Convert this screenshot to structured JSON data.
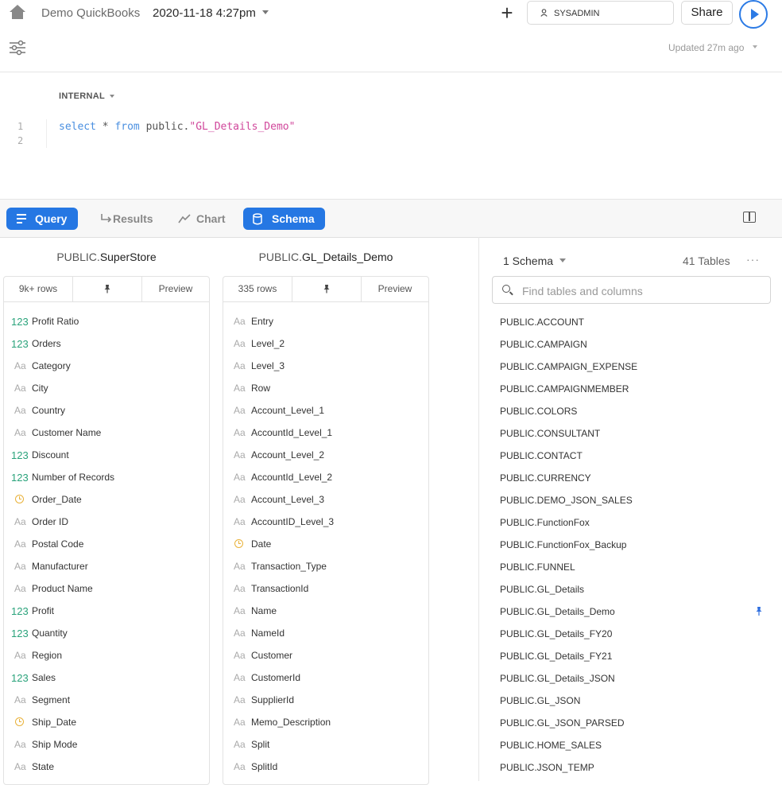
{
  "header": {
    "app_name": "Demo QuickBooks",
    "worksheet_title": "2020-11-18 4:27pm",
    "role": "SYSADMIN",
    "share_label": "Share",
    "updated": "Updated 27m ago"
  },
  "editor": {
    "database": "INTERNAL",
    "line_numbers": [
      "1",
      "2"
    ],
    "sql": {
      "kw_select": "select",
      "star": " * ",
      "kw_from": "from",
      "schema": " public.",
      "table_str": "\"GL_Details_Demo\""
    }
  },
  "toolbar": {
    "tabs": [
      {
        "label": "Query"
      },
      {
        "label": "Results"
      },
      {
        "label": "Chart"
      },
      {
        "label": "Schema"
      }
    ]
  },
  "cards": [
    {
      "schema_prefix": "PUBLIC.",
      "table_name": "SuperStore",
      "rows": "9k+ rows",
      "preview": "Preview",
      "columns": [
        {
          "type": "num",
          "type_label": "123",
          "name": "Profit Ratio"
        },
        {
          "type": "num",
          "type_label": "123",
          "name": "Orders"
        },
        {
          "type": "txt",
          "type_label": "Aa",
          "name": "Category"
        },
        {
          "type": "txt",
          "type_label": "Aa",
          "name": "City"
        },
        {
          "type": "txt",
          "type_label": "Aa",
          "name": "Country"
        },
        {
          "type": "txt",
          "type_label": "Aa",
          "name": "Customer Name"
        },
        {
          "type": "num",
          "type_label": "123",
          "name": "Discount"
        },
        {
          "type": "num",
          "type_label": "123",
          "name": "Number of Records"
        },
        {
          "type": "date",
          "type_label": "",
          "name": "Order_Date"
        },
        {
          "type": "txt",
          "type_label": "Aa",
          "name": "Order ID"
        },
        {
          "type": "txt",
          "type_label": "Aa",
          "name": "Postal Code"
        },
        {
          "type": "txt",
          "type_label": "Aa",
          "name": "Manufacturer"
        },
        {
          "type": "txt",
          "type_label": "Aa",
          "name": "Product Name"
        },
        {
          "type": "num",
          "type_label": "123",
          "name": "Profit"
        },
        {
          "type": "num",
          "type_label": "123",
          "name": "Quantity"
        },
        {
          "type": "txt",
          "type_label": "Aa",
          "name": "Region"
        },
        {
          "type": "num",
          "type_label": "123",
          "name": "Sales"
        },
        {
          "type": "txt",
          "type_label": "Aa",
          "name": "Segment"
        },
        {
          "type": "date",
          "type_label": "",
          "name": "Ship_Date"
        },
        {
          "type": "txt",
          "type_label": "Aa",
          "name": "Ship Mode"
        },
        {
          "type": "txt",
          "type_label": "Aa",
          "name": "State"
        }
      ]
    },
    {
      "schema_prefix": "PUBLIC.",
      "table_name": "GL_Details_Demo",
      "rows": "335 rows",
      "preview": "Preview",
      "columns": [
        {
          "type": "txt",
          "type_label": "Aa",
          "name": "Entry"
        },
        {
          "type": "txt",
          "type_label": "Aa",
          "name": "Level_2"
        },
        {
          "type": "txt",
          "type_label": "Aa",
          "name": "Level_3"
        },
        {
          "type": "txt",
          "type_label": "Aa",
          "name": "Row"
        },
        {
          "type": "txt",
          "type_label": "Aa",
          "name": "Account_Level_1"
        },
        {
          "type": "txt",
          "type_label": "Aa",
          "name": "AccountId_Level_1"
        },
        {
          "type": "txt",
          "type_label": "Aa",
          "name": "Account_Level_2"
        },
        {
          "type": "txt",
          "type_label": "Aa",
          "name": "AccountId_Level_2"
        },
        {
          "type": "txt",
          "type_label": "Aa",
          "name": "Account_Level_3"
        },
        {
          "type": "txt",
          "type_label": "Aa",
          "name": "AccountID_Level_3"
        },
        {
          "type": "date",
          "type_label": "",
          "name": "Date"
        },
        {
          "type": "txt",
          "type_label": "Aa",
          "name": "Transaction_Type"
        },
        {
          "type": "txt",
          "type_label": "Aa",
          "name": "TransactionId"
        },
        {
          "type": "txt",
          "type_label": "Aa",
          "name": "Name"
        },
        {
          "type": "txt",
          "type_label": "Aa",
          "name": "NameId"
        },
        {
          "type": "txt",
          "type_label": "Aa",
          "name": "Customer"
        },
        {
          "type": "txt",
          "type_label": "Aa",
          "name": "CustomerId"
        },
        {
          "type": "txt",
          "type_label": "Aa",
          "name": "SupplierId"
        },
        {
          "type": "txt",
          "type_label": "Aa",
          "name": "Memo_Description"
        },
        {
          "type": "txt",
          "type_label": "Aa",
          "name": "Split"
        },
        {
          "type": "txt",
          "type_label": "Aa",
          "name": "SplitId"
        }
      ]
    }
  ],
  "schema_panel": {
    "schema_count": "1 Schema",
    "tables_count": "41 Tables",
    "more": "···",
    "search_placeholder": "Find tables and columns",
    "tables": [
      "PUBLIC.ACCOUNT",
      "PUBLIC.CAMPAIGN",
      "PUBLIC.CAMPAIGN_EXPENSE",
      "PUBLIC.CAMPAIGNMEMBER",
      "PUBLIC.COLORS",
      "PUBLIC.CONSULTANT",
      "PUBLIC.CONTACT",
      "PUBLIC.CURRENCY",
      "PUBLIC.DEMO_JSON_SALES",
      "PUBLIC.FunctionFox",
      "PUBLIC.FunctionFox_Backup",
      "PUBLIC.FUNNEL",
      "PUBLIC.GL_Details",
      "PUBLIC.GL_Details_Demo",
      "PUBLIC.GL_Details_FY20",
      "PUBLIC.GL_Details_FY21",
      "PUBLIC.GL_Details_JSON",
      "PUBLIC.GL_JSON",
      "PUBLIC.GL_JSON_PARSED",
      "PUBLIC.HOME_SALES",
      "PUBLIC.JSON_TEMP"
    ],
    "pinned_table": "PUBLIC.GL_Details_Demo"
  },
  "colors": {
    "accent": "#2577e3",
    "number_type": "#2aa37b",
    "date_type": "#e9b23a",
    "sql_keyword": "#4a8fe0",
    "sql_string": "#d0479b"
  }
}
